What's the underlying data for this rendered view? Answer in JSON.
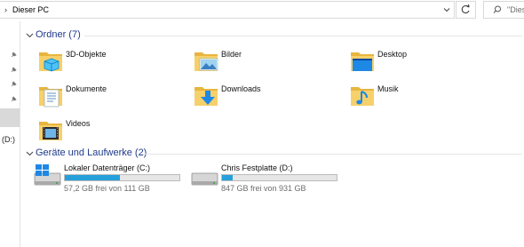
{
  "address": {
    "separator": "›",
    "path": "Dieser PC"
  },
  "search": {
    "placeholder": "\"Dies"
  },
  "nav": {
    "drive_label": "(D:)"
  },
  "sections": {
    "folders": {
      "title": "Ordner (7)"
    },
    "drives": {
      "title": "Geräte und Laufwerke (2)"
    }
  },
  "folders": [
    {
      "label": "3D-Objekte",
      "icon": "3d-objects-folder-icon"
    },
    {
      "label": "Bilder",
      "icon": "pictures-folder-icon"
    },
    {
      "label": "Desktop",
      "icon": "desktop-folder-icon"
    },
    {
      "label": "Dokumente",
      "icon": "documents-folder-icon"
    },
    {
      "label": "Downloads",
      "icon": "downloads-folder-icon"
    },
    {
      "label": "Musik",
      "icon": "music-folder-icon"
    },
    {
      "label": "Videos",
      "icon": "videos-folder-icon"
    }
  ],
  "drives": [
    {
      "name": "Lokaler Datenträger (C:)",
      "info": "57,2 GB frei von 111 GB",
      "used_fraction": 0.48,
      "icon": "windows-drive-icon"
    },
    {
      "name": "Chris Festplatte (D:)",
      "info": "847 GB frei von 931 GB",
      "used_fraction": 0.09,
      "icon": "hard-drive-icon"
    }
  ],
  "colors": {
    "accent": "#26a0da",
    "section_title": "#1e3a8a",
    "folder": "#f4c956"
  }
}
